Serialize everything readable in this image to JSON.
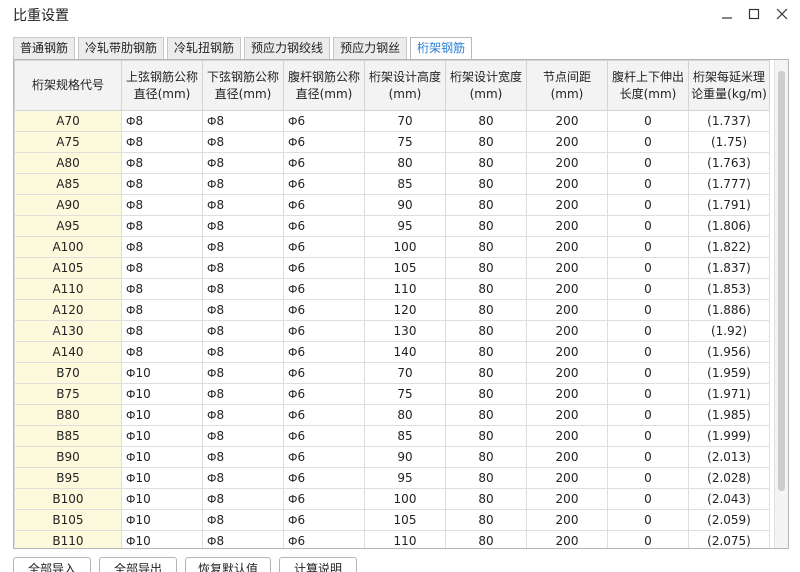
{
  "window": {
    "title": "比重设置"
  },
  "tabs": [
    "普通钢筋",
    "冷轧带肋钢筋",
    "冷轧扭钢筋",
    "预应力钢绞线",
    "预应力钢丝",
    "桁架钢筋"
  ],
  "columns": [
    "桁架规格代号",
    "上弦钢筋公称直径(mm)",
    "下弦钢筋公称直径(mm)",
    "腹杆钢筋公称直径(mm)",
    "桁架设计高度(mm)",
    "桁架设计宽度(mm)",
    "节点间距(mm)",
    "腹杆上下伸出长度(mm)",
    "桁架每延米理论重量(kg/m)"
  ],
  "rows": [
    [
      "A70",
      "8",
      "8",
      "6",
      "70",
      "80",
      "200",
      "0",
      "(1.737)"
    ],
    [
      "A75",
      "8",
      "8",
      "6",
      "75",
      "80",
      "200",
      "0",
      "(1.75)"
    ],
    [
      "A80",
      "8",
      "8",
      "6",
      "80",
      "80",
      "200",
      "0",
      "(1.763)"
    ],
    [
      "A85",
      "8",
      "8",
      "6",
      "85",
      "80",
      "200",
      "0",
      "(1.777)"
    ],
    [
      "A90",
      "8",
      "8",
      "6",
      "90",
      "80",
      "200",
      "0",
      "(1.791)"
    ],
    [
      "A95",
      "8",
      "8",
      "6",
      "95",
      "80",
      "200",
      "0",
      "(1.806)"
    ],
    [
      "A100",
      "8",
      "8",
      "6",
      "100",
      "80",
      "200",
      "0",
      "(1.822)"
    ],
    [
      "A105",
      "8",
      "8",
      "6",
      "105",
      "80",
      "200",
      "0",
      "(1.837)"
    ],
    [
      "A110",
      "8",
      "8",
      "6",
      "110",
      "80",
      "200",
      "0",
      "(1.853)"
    ],
    [
      "A120",
      "8",
      "8",
      "6",
      "120",
      "80",
      "200",
      "0",
      "(1.886)"
    ],
    [
      "A130",
      "8",
      "8",
      "6",
      "130",
      "80",
      "200",
      "0",
      "(1.92)"
    ],
    [
      "A140",
      "8",
      "8",
      "6",
      "140",
      "80",
      "200",
      "0",
      "(1.956)"
    ],
    [
      "B70",
      "10",
      "8",
      "6",
      "70",
      "80",
      "200",
      "0",
      "(1.959)"
    ],
    [
      "B75",
      "10",
      "8",
      "6",
      "75",
      "80",
      "200",
      "0",
      "(1.971)"
    ],
    [
      "B80",
      "10",
      "8",
      "6",
      "80",
      "80",
      "200",
      "0",
      "(1.985)"
    ],
    [
      "B85",
      "10",
      "8",
      "6",
      "85",
      "80",
      "200",
      "0",
      "(1.999)"
    ],
    [
      "B90",
      "10",
      "8",
      "6",
      "90",
      "80",
      "200",
      "0",
      "(2.013)"
    ],
    [
      "B95",
      "10",
      "8",
      "6",
      "95",
      "80",
      "200",
      "0",
      "(2.028)"
    ],
    [
      "B100",
      "10",
      "8",
      "6",
      "100",
      "80",
      "200",
      "0",
      "(2.043)"
    ],
    [
      "B105",
      "10",
      "8",
      "6",
      "105",
      "80",
      "200",
      "0",
      "(2.059)"
    ],
    [
      "B110",
      "10",
      "8",
      "6",
      "110",
      "80",
      "200",
      "0",
      "(2.075)"
    ]
  ],
  "bar_symbols": {
    "hrb400": "Ф",
    "hpb300": "Ф"
  },
  "buttons": [
    "全部导入",
    "全部导出",
    "恢复默认值",
    "计算说明"
  ],
  "colors": {
    "active_tab": "#2a7fd4",
    "code_cell_bg": "#fdf9dc"
  }
}
